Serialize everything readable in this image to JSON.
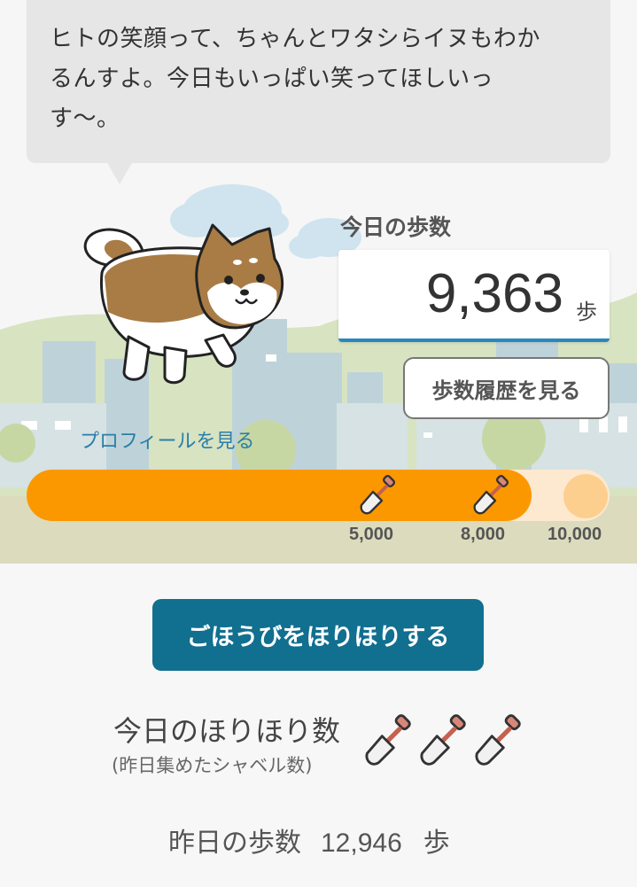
{
  "speech": {
    "line1": "ヒトの笑顔って、ちゃんとワタシらイヌもわか",
    "line2": "るんすよ。今日もいっぱい笑ってほしいっ",
    "line3": "す〜。"
  },
  "today_steps": {
    "label": "今日の歩数",
    "value": "9,363",
    "unit": "歩"
  },
  "history_button": "歩数履歴を見る",
  "profile_link": "プロフィールを見る",
  "progress": {
    "current": 9363,
    "goal": 10000,
    "milestones": [
      "5,000",
      "8,000",
      "10,000"
    ]
  },
  "dig_button": "ごほうびをほりほりする",
  "dig_count": {
    "label": "今日のほりほり数",
    "sublabel": "(昨日集めたシャベル数)",
    "shovels": 3
  },
  "yesterday": {
    "label": "昨日の歩数",
    "value": "12,946",
    "unit": "歩"
  },
  "colors": {
    "accent": "#116f8f",
    "progress": "#fb9800",
    "link": "#2a7fa8",
    "dog": "#b08040"
  },
  "icons": [
    "shiba-dog-icon",
    "shovel-icon"
  ]
}
